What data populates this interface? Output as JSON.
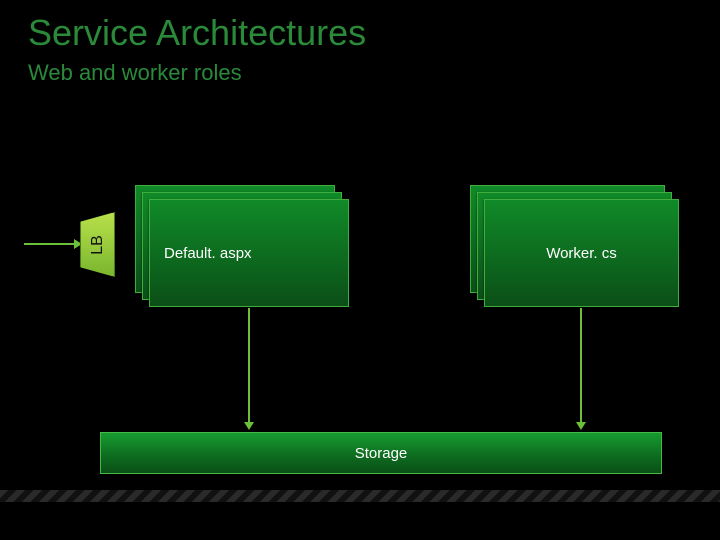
{
  "title": "Service Architectures",
  "subtitle": "Web and worker roles",
  "lb": {
    "label": "LB"
  },
  "web_role": {
    "label": "Default. aspx"
  },
  "worker_role": {
    "label": "Worker. cs"
  },
  "storage": {
    "label": "Storage"
  }
}
